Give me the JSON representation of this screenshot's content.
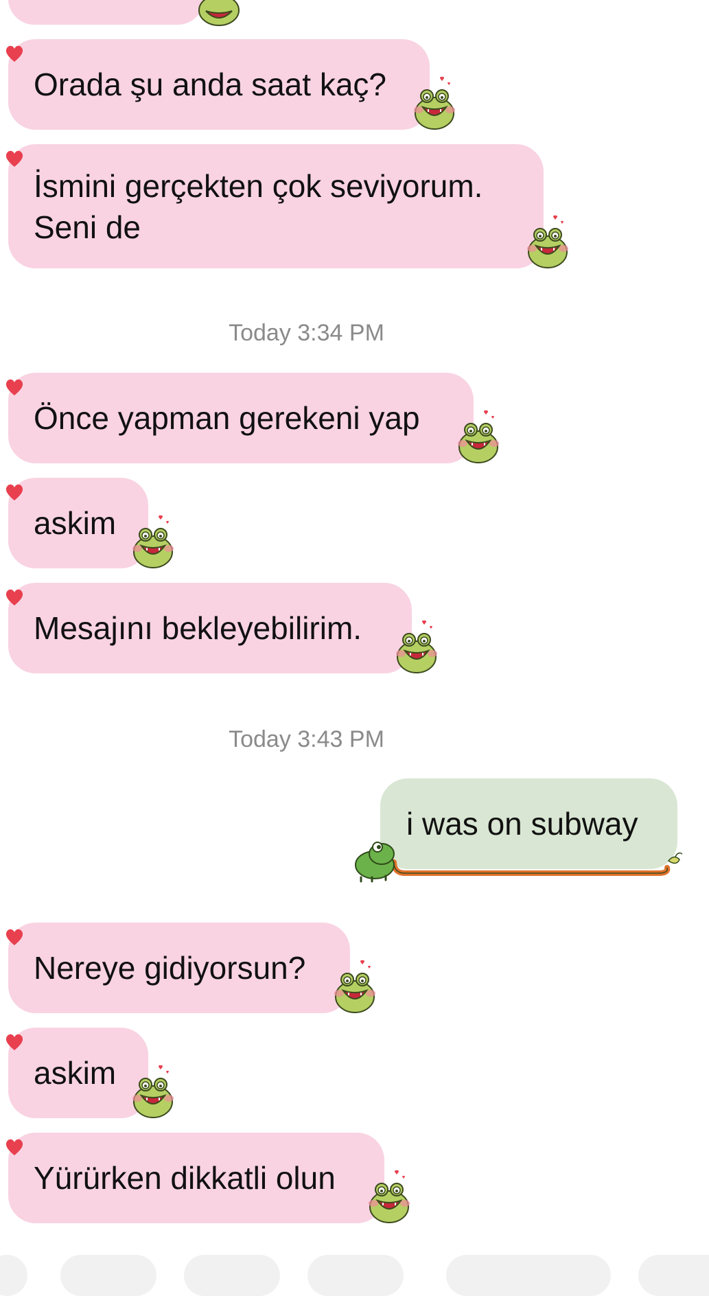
{
  "colors": {
    "incoming_bubble": "#f9d3e2",
    "outgoing_bubble": "#d9e6d3",
    "heart": "#e8404f",
    "timestamp_text": "#8a8a8a",
    "sticker_tongue": "#e0722a"
  },
  "reaction_icon": "heart-icon",
  "incoming_sticker": "lovestruck-frog-sticker",
  "outgoing_sticker": "lizard-tongue-sticker",
  "messages": [
    {
      "text": "Orada şu anda saat kaç?"
    },
    {
      "text": "İsmini gerçekten çok seviyorum.\nSeni de"
    },
    {
      "text": "Önce yapman gerekeni yap"
    },
    {
      "text": "askim"
    },
    {
      "text": "Mesajını bekleyebilirim."
    },
    {
      "text": "i was on subway"
    },
    {
      "text": "Nereye gidiyorsun?"
    },
    {
      "text": "askim"
    },
    {
      "text": "Yürürken dikkatli olun"
    }
  ],
  "timestamps": [
    "Today 3:34 PM",
    "Today 3:43 PM"
  ]
}
